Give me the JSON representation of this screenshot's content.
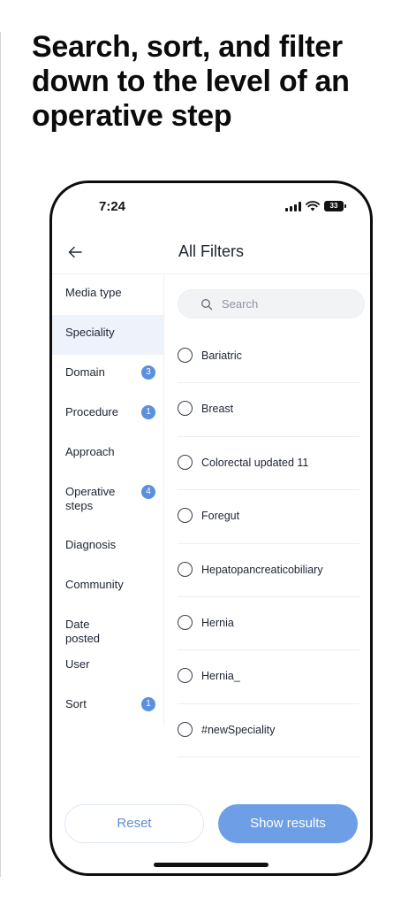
{
  "headline": "Search, sort, and filter down to the level of an operative step",
  "status_bar": {
    "time": "7:24",
    "battery": "33"
  },
  "header": {
    "title": "All Filters",
    "back_icon": "arrow-left-icon"
  },
  "sidebar": {
    "items": [
      {
        "label": "Media type",
        "badge": null,
        "active": false
      },
      {
        "label": "Speciality",
        "badge": null,
        "active": true
      },
      {
        "label": "Domain",
        "badge": "3",
        "active": false
      },
      {
        "label": "Procedure",
        "badge": "1",
        "active": false
      },
      {
        "label": "Approach",
        "badge": null,
        "active": false
      },
      {
        "label": "Operative steps",
        "badge": "4",
        "active": false
      },
      {
        "label": "Diagnosis",
        "badge": null,
        "active": false
      },
      {
        "label": "Community",
        "badge": null,
        "active": false
      },
      {
        "label": "Date posted",
        "badge": null,
        "active": false
      },
      {
        "label": "User",
        "badge": null,
        "active": false
      },
      {
        "label": "Sort",
        "badge": "1",
        "active": false
      }
    ]
  },
  "search": {
    "placeholder": "Search",
    "value": "",
    "icon": "search-icon"
  },
  "options": [
    {
      "label": "Bariatric",
      "selected": false
    },
    {
      "label": "Breast",
      "selected": false
    },
    {
      "label": "Colorectal updated 11",
      "selected": false
    },
    {
      "label": "Foregut",
      "selected": false
    },
    {
      "label": "Hepatopancreaticobiliary",
      "selected": false
    },
    {
      "label": "Hernia",
      "selected": false
    },
    {
      "label": "Hernia_",
      "selected": false
    },
    {
      "label": "#newSpeciality",
      "selected": false
    }
  ],
  "footer": {
    "reset_label": "Reset",
    "show_results_label": "Show results"
  },
  "colors": {
    "accent": "#6d9ee6",
    "badge": "#5b8fe0",
    "active_bg": "#eef2fb"
  }
}
